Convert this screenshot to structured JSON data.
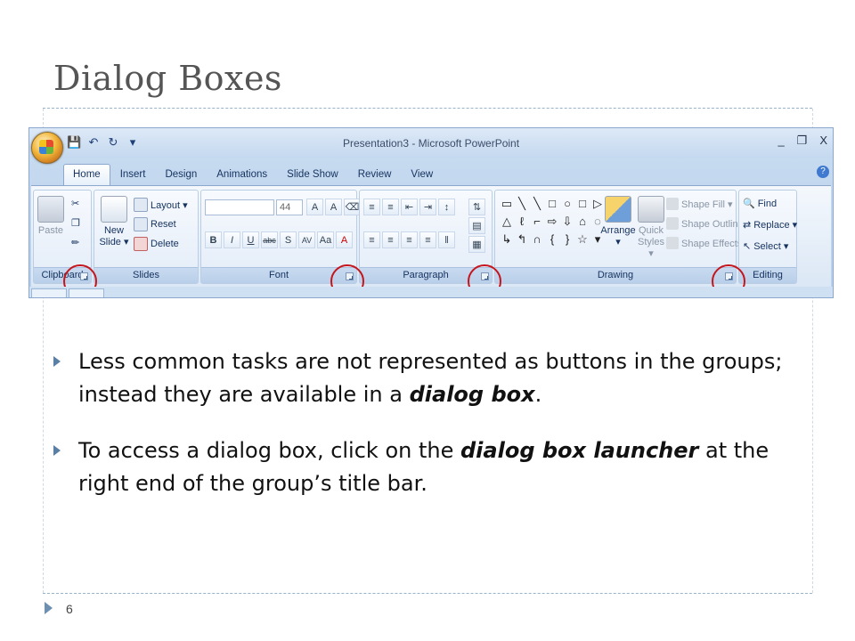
{
  "slide": {
    "title": "Dialog Boxes",
    "page_number": "6"
  },
  "bullets": [
    {
      "before": "Less common tasks are not represented as buttons in the groups; instead they are available in a ",
      "emphasis": "dialog box",
      "after": "."
    },
    {
      "before": "To access a dialog box, click on the ",
      "emphasis": "dialog box launcher",
      "after": " at the right end of the group’s title bar."
    }
  ],
  "ppt": {
    "window_title": "Presentation3 - Microsoft PowerPoint",
    "qat": {
      "save_icon": "save-icon",
      "undo_icon": "undo-icon",
      "redo_icon": "redo-icon",
      "customize": "▾"
    },
    "window_controls": {
      "minimize": "_",
      "restore": "❐",
      "close": "X"
    },
    "tabs": [
      "Home",
      "Insert",
      "Design",
      "Animations",
      "Slide Show",
      "Review",
      "View"
    ],
    "active_tab": "Home",
    "help": "?",
    "groups": {
      "clipboard": {
        "label": "Clipboard",
        "paste": "Paste"
      },
      "slides": {
        "label": "Slides",
        "new_slide_1": "New",
        "new_slide_2": "Slide ▾",
        "layout": "Layout ▾",
        "reset": "Reset",
        "delete": "Delete"
      },
      "font": {
        "label": "Font",
        "font_name": "",
        "font_size": "44"
      },
      "paragraph": {
        "label": "Paragraph"
      },
      "drawing": {
        "label": "Drawing",
        "arrange": "Arrange",
        "quick_styles_1": "Quick",
        "quick_styles_2": "Styles ▾",
        "shape_fill": "Shape Fill ▾",
        "shape_outline": "Shape Outline ▾",
        "shape_effects": "Shape Effects ▾"
      },
      "editing": {
        "label": "Editing",
        "find": "Find",
        "replace": "Replace ▾",
        "select": "Select ▾"
      }
    },
    "font_buttons": [
      "B",
      "I",
      "U",
      "abc",
      "S",
      "AV",
      "Aa",
      "A"
    ],
    "shape_glyphs": [
      "▭",
      "╲",
      "╲",
      "□",
      "○",
      "□",
      "▷",
      "△",
      "ℓ",
      "⌐",
      "⇨",
      "⇩",
      "⌂",
      "◌",
      "↳",
      "↰",
      "∩",
      "{",
      "}",
      "☆",
      "▾"
    ],
    "colors": {
      "highlight_circle": "#c4161c",
      "ribbon_text": "#15325e",
      "bullet_marker": "#5a7fa6"
    }
  }
}
